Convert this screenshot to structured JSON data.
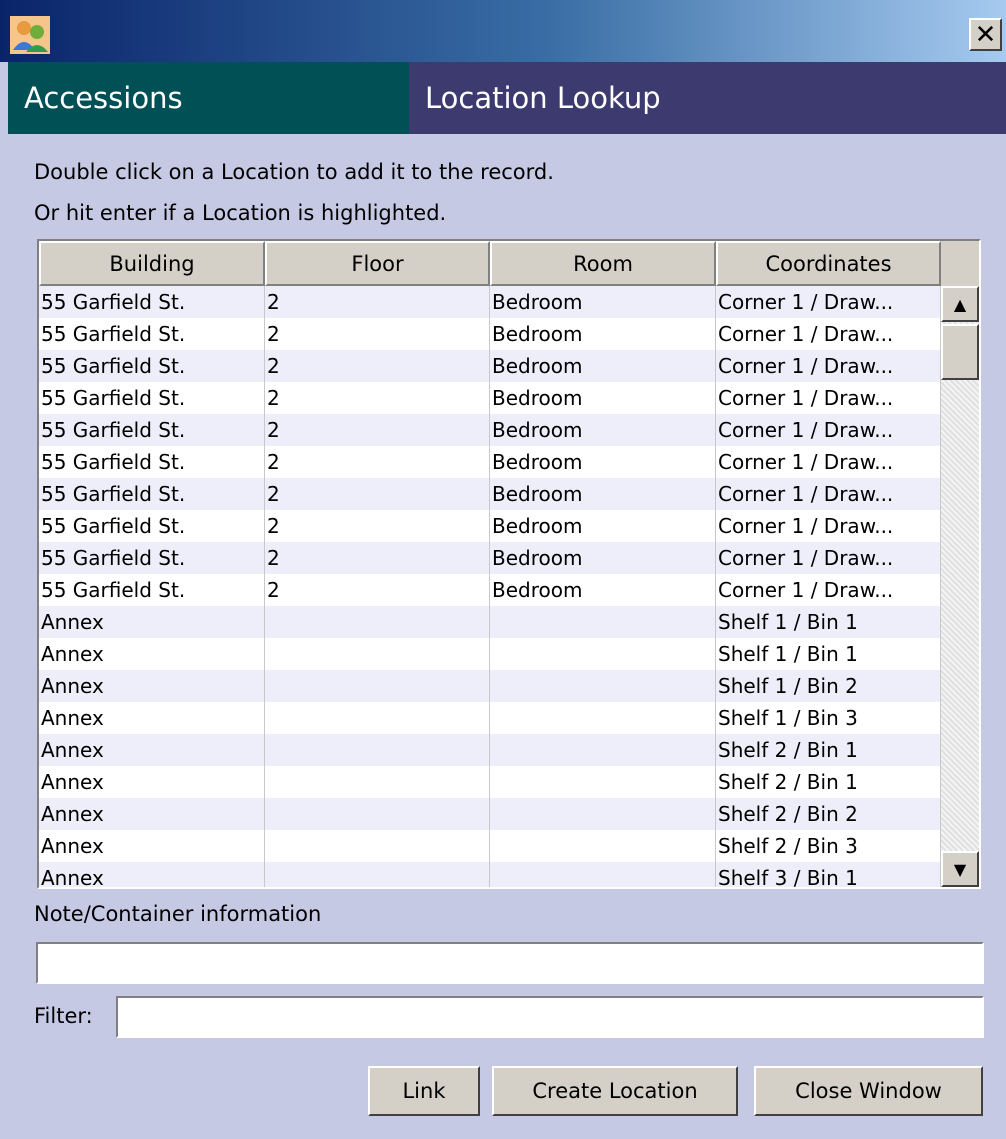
{
  "window": {
    "close_label": "✕",
    "icon": "users-icon"
  },
  "header": {
    "left": "Accessions",
    "right": "Location Lookup"
  },
  "instructions": {
    "line1": "Double click on a Location to add it to the record.",
    "line2": "Or hit enter if a Location is highlighted."
  },
  "table": {
    "columns": [
      "Building",
      "Floor",
      "Room",
      "Coordinates"
    ],
    "rows": [
      [
        "55 Garfield St.",
        "2",
        "Bedroom",
        "Corner 1 / Draw..."
      ],
      [
        "55 Garfield St.",
        "2",
        "Bedroom",
        "Corner 1 / Draw..."
      ],
      [
        "55 Garfield St.",
        "2",
        "Bedroom",
        "Corner 1 / Draw..."
      ],
      [
        "55 Garfield St.",
        "2",
        "Bedroom",
        "Corner 1 / Draw..."
      ],
      [
        "55 Garfield St.",
        "2",
        "Bedroom",
        "Corner 1 / Draw..."
      ],
      [
        "55 Garfield St.",
        "2",
        "Bedroom",
        "Corner 1 / Draw..."
      ],
      [
        "55 Garfield St.",
        "2",
        "Bedroom",
        "Corner 1 / Draw..."
      ],
      [
        "55 Garfield St.",
        "2",
        "Bedroom",
        "Corner 1 / Draw..."
      ],
      [
        "55 Garfield St.",
        "2",
        "Bedroom",
        "Corner 1 / Draw..."
      ],
      [
        "55 Garfield St.",
        "2",
        "Bedroom",
        "Corner 1 / Draw..."
      ],
      [
        "Annex",
        "",
        "",
        "Shelf 1 / Bin 1"
      ],
      [
        "Annex",
        "",
        "",
        "Shelf 1 / Bin 1"
      ],
      [
        "Annex",
        "",
        "",
        "Shelf 1 / Bin 2"
      ],
      [
        "Annex",
        "",
        "",
        "Shelf 1 / Bin 3"
      ],
      [
        "Annex",
        "",
        "",
        "Shelf 2 / Bin 1"
      ],
      [
        "Annex",
        "",
        "",
        "Shelf 2 / Bin 1"
      ],
      [
        "Annex",
        "",
        "",
        "Shelf 2 / Bin 2"
      ],
      [
        "Annex",
        "",
        "",
        "Shelf 2 / Bin 3"
      ],
      [
        "Annex",
        "",
        "",
        "Shelf 3 / Bin 1"
      ]
    ]
  },
  "note": {
    "label": "Note/Container information",
    "value": ""
  },
  "filter": {
    "label": "Filter:",
    "value": ""
  },
  "buttons": {
    "link": "Link",
    "create": "Create Location",
    "close": "Close Window"
  },
  "colors": {
    "background": "#c6c9e4",
    "header_left": "#005055",
    "header_right": "#3c3a6e",
    "row_alt": "#eeeefa"
  }
}
